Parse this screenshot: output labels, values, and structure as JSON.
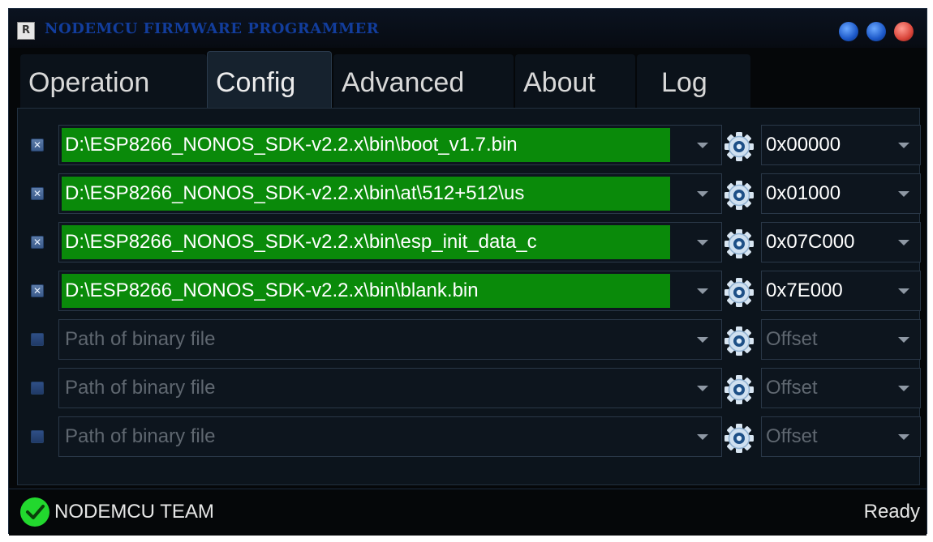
{
  "window": {
    "title": "NODEMCU FIRMWARE PROGRAMMER",
    "icon_label": "R"
  },
  "tabs": [
    {
      "label": "Operation",
      "active": false
    },
    {
      "label": "Config",
      "active": true
    },
    {
      "label": "Advanced",
      "active": false
    },
    {
      "label": "About",
      "active": false
    },
    {
      "label": "Log",
      "active": false
    }
  ],
  "rows": [
    {
      "checked": true,
      "path": "D:\\ESP8266_NONOS_SDK-v2.2.x\\bin\\boot_v1.7.bin",
      "offset": "0x00000"
    },
    {
      "checked": true,
      "path": "D:\\ESP8266_NONOS_SDK-v2.2.x\\bin\\at\\512+512\\us",
      "offset": "0x01000"
    },
    {
      "checked": true,
      "path": "D:\\ESP8266_NONOS_SDK-v2.2.x\\bin\\esp_init_data_c",
      "offset": "0x07C000"
    },
    {
      "checked": true,
      "path": "D:\\ESP8266_NONOS_SDK-v2.2.x\\bin\\blank.bin",
      "offset": "0x7E000"
    },
    {
      "checked": false,
      "path": "Path of binary file",
      "offset": "Offset"
    },
    {
      "checked": false,
      "path": "Path of binary file",
      "offset": "Offset"
    },
    {
      "checked": false,
      "path": "Path of binary file",
      "offset": "Offset"
    }
  ],
  "status": {
    "left": "NODEMCU TEAM",
    "right": "Ready"
  },
  "icons": {
    "app": "app-logo-icon",
    "settings": "gear-icon",
    "status": "checkmark-icon",
    "dropdown": "chevron-down-icon"
  },
  "colors": {
    "filled_path_bg": "#0a8a0a",
    "background": "#050709",
    "panel": "#0c141c",
    "status_ok": "#22d82e"
  }
}
